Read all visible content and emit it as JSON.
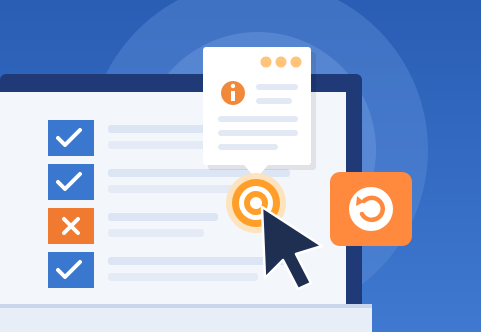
{
  "illustration": {
    "colors": {
      "bg_top": "#2a5db4",
      "bg_bottom": "#3f79d0",
      "halo": "#6f9fe0",
      "laptop_frame": "#203a78",
      "screen": "#f3f6fb",
      "line": "#dbe5f3",
      "check": "#3a77cf",
      "cross": "#f07a2f",
      "accent": "#ff9f2a",
      "undo": "#ff8a3d",
      "cursor": "#1e2f52",
      "popup_dot": "#ffc37a",
      "info": "#f08a3a"
    },
    "checklist": [
      {
        "icon": "check-icon"
      },
      {
        "icon": "check-icon"
      },
      {
        "icon": "close-icon"
      },
      {
        "icon": "check-icon"
      }
    ],
    "popup": {
      "icon": "info-icon"
    },
    "action_button": {
      "icon": "undo-icon"
    },
    "click_target": {
      "icon": "target-icon"
    },
    "cursor": {
      "icon": "cursor-icon"
    }
  }
}
